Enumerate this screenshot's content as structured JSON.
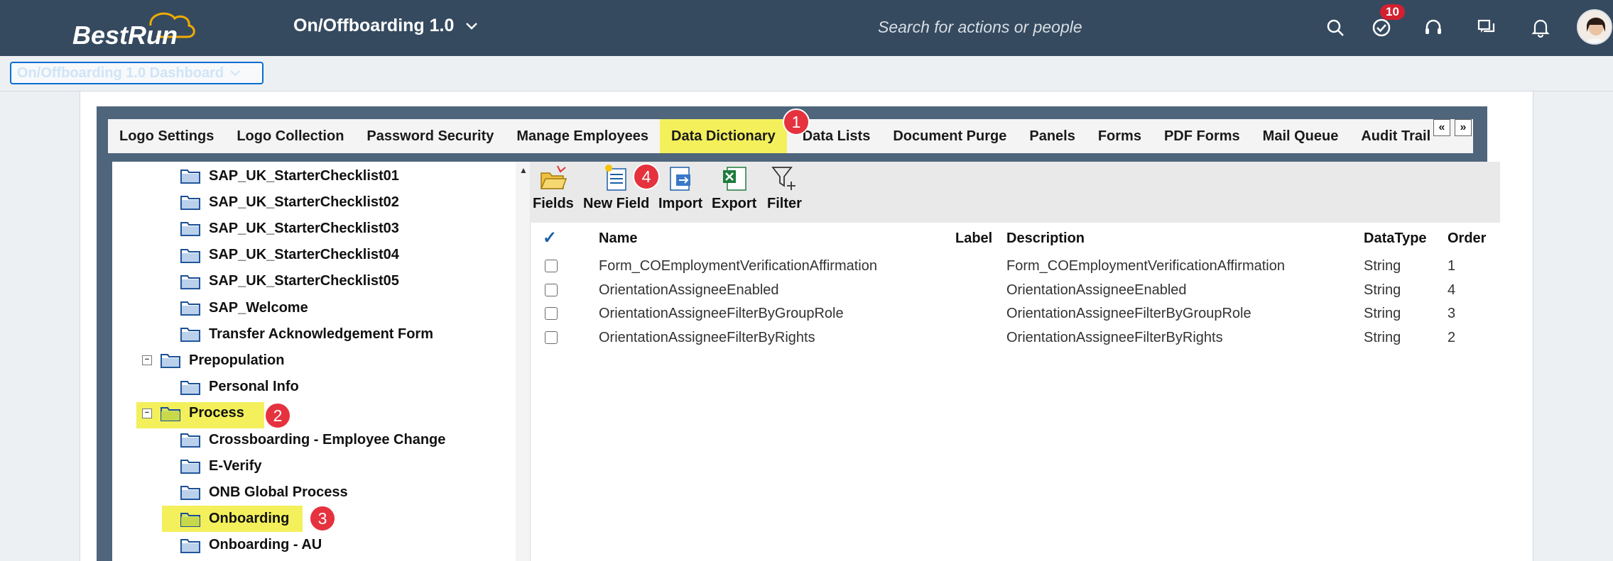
{
  "shell": {
    "logo_text": "BestRun",
    "app_title": "On/Offboarding 1.0",
    "search_placeholder": "Search for actions or people",
    "todo_badge": "10",
    "icons": [
      "search-icon",
      "todo-icon",
      "headset-icon",
      "feedback-icon",
      "bell-icon"
    ]
  },
  "subheader": {
    "dashboard_select": "On/Offboarding 1.0 Dashboard"
  },
  "tabs": [
    {
      "label": "Logo Settings"
    },
    {
      "label": "Logo Collection"
    },
    {
      "label": "Password Security"
    },
    {
      "label": "Manage Employees"
    },
    {
      "label": "Data Dictionary",
      "active": true
    },
    {
      "label": "Data Lists"
    },
    {
      "label": "Document Purge"
    },
    {
      "label": "Panels"
    },
    {
      "label": "Forms"
    },
    {
      "label": "PDF Forms"
    },
    {
      "label": "Mail Queue"
    },
    {
      "label": "Audit Trail"
    }
  ],
  "tab_nav": {
    "prev": "«",
    "next": "»"
  },
  "tree": [
    {
      "label": "SAP_UK_StarterChecklist01"
    },
    {
      "label": "SAP_UK_StarterChecklist02"
    },
    {
      "label": "SAP_UK_StarterChecklist03"
    },
    {
      "label": "SAP_UK_StarterChecklist04"
    },
    {
      "label": "SAP_UK_StarterChecklist05"
    },
    {
      "label": "SAP_Welcome"
    },
    {
      "label": "Transfer Acknowledgement Form"
    },
    {
      "label": "Prepopulation",
      "toggle": "−"
    },
    {
      "label": "Personal Info"
    },
    {
      "label": "Process",
      "toggle": "−",
      "highlight": true
    },
    {
      "label": "Crossboarding - Employee Change"
    },
    {
      "label": "E-Verify"
    },
    {
      "label": "ONB Global Process"
    },
    {
      "label": "Onboarding",
      "highlight": true
    },
    {
      "label": "Onboarding - AU"
    }
  ],
  "toolbar": {
    "fields": "Fields",
    "new_field": "New Field",
    "import": "Import",
    "export": "Export",
    "filter": "Filter"
  },
  "grid": {
    "select_all_mark": "✓",
    "headers": {
      "name": "Name",
      "label": "Label",
      "description": "Description",
      "datatype": "DataType",
      "order": "Order"
    },
    "rows": [
      {
        "name": "Form_COEmploymentVerificationAffirmation",
        "label": "",
        "description": "Form_COEmploymentVerificationAffirmation",
        "datatype": "String",
        "order": "1"
      },
      {
        "name": "OrientationAssigneeEnabled",
        "label": "",
        "description": "OrientationAssigneeEnabled",
        "datatype": "String",
        "order": "4"
      },
      {
        "name": "OrientationAssigneeFilterByGroupRole",
        "label": "",
        "description": "OrientationAssigneeFilterByGroupRole",
        "datatype": "String",
        "order": "3"
      },
      {
        "name": "OrientationAssigneeFilterByRights",
        "label": "",
        "description": "OrientationAssigneeFilterByRights",
        "datatype": "String",
        "order": "2"
      }
    ]
  },
  "steps": [
    "1",
    "2",
    "3",
    "4"
  ],
  "colors": {
    "shell": "#354a5f",
    "admin_frame": "#4e657c",
    "highlight": "#f3f05b",
    "step_marker": "#e5323e",
    "badge": "#d32030"
  }
}
